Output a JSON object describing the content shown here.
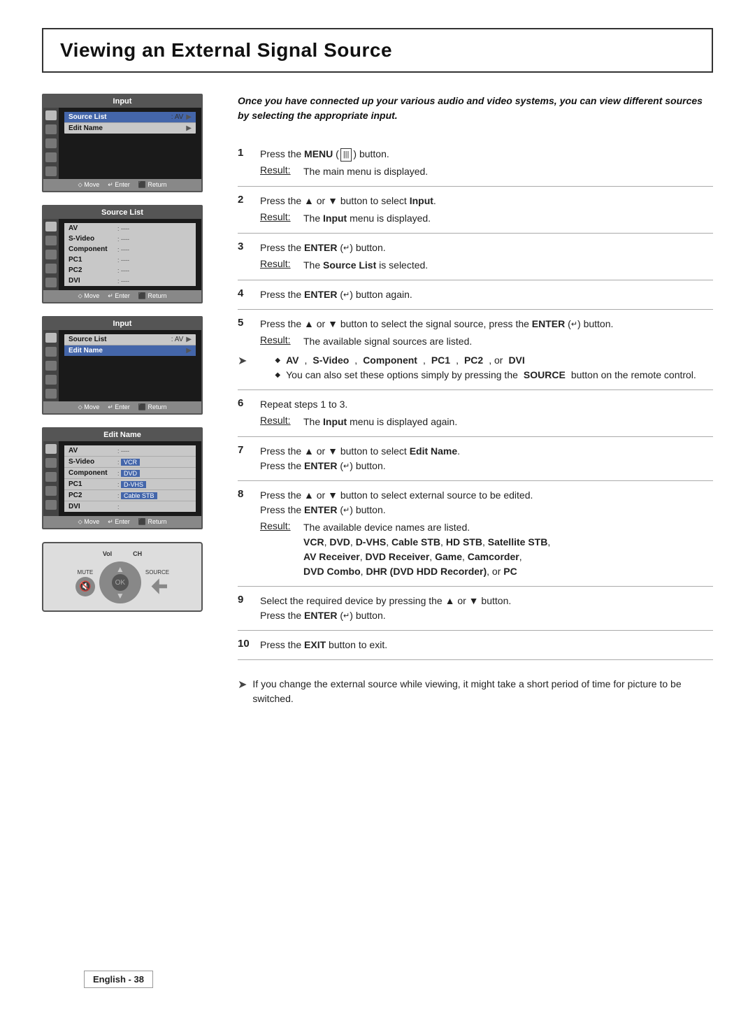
{
  "page": {
    "title": "Viewing an External Signal Source",
    "footer": "English - 38"
  },
  "intro": {
    "text": "Once you have connected up your various audio and video systems, you can view different sources by selecting the appropriate input."
  },
  "panels": {
    "panel1": {
      "header": "Input",
      "rows": [
        {
          "label": "Source List",
          "value": ": AV",
          "hasArrow": true,
          "selected": true
        },
        {
          "label": "Edit Name",
          "value": "",
          "hasArrow": true,
          "selected": false
        }
      ]
    },
    "panel2": {
      "header": "Source List",
      "rows": [
        {
          "label": "AV",
          "value": " : ----"
        },
        {
          "label": "S-Video",
          "value": " : ----"
        },
        {
          "label": "Component",
          "value": " : ----"
        },
        {
          "label": "PC1",
          "value": " : ----"
        },
        {
          "label": "PC2",
          "value": " : ----"
        },
        {
          "label": "DVI",
          "value": " : ----"
        }
      ]
    },
    "panel3": {
      "header": "Input",
      "rows": [
        {
          "label": "Source List",
          "value": ": AV",
          "hasArrow": true,
          "selected": false
        },
        {
          "label": "Edit Name",
          "value": "",
          "hasArrow": true,
          "selected": true
        }
      ]
    },
    "panel4": {
      "header": "Edit Name",
      "rows": [
        {
          "label": "AV",
          "value": "----"
        },
        {
          "label": "S-Video",
          "value": "VCR"
        },
        {
          "label": "Component",
          "value": "DVD"
        },
        {
          "label": "PC1",
          "value": "D-VHS"
        },
        {
          "label": "PC2",
          "value": "Cable STB"
        },
        {
          "label": "DVI",
          "value": ""
        }
      ]
    }
  },
  "footer_nav": {
    "move": "⬦ Move",
    "enter": "↵ Enter",
    "return": "⬛ Return"
  },
  "remote": {
    "vol_label": "Vol",
    "ch_label": "CH",
    "mute_label": "MUTE",
    "source_label": "SOURCE"
  },
  "steps": [
    {
      "num": "1",
      "text_parts": [
        "Press the ",
        "MENU",
        " (",
        "|||",
        ") button."
      ],
      "result": "The main menu is displayed."
    },
    {
      "num": "2",
      "text_parts": [
        "Press the ▲ or ▼ button to select ",
        "Input",
        "."
      ],
      "result_prefix": "The ",
      "result_bold": "Input",
      "result_suffix": " menu is displayed."
    },
    {
      "num": "3",
      "text_parts": [
        "Press the ",
        "ENTER",
        " (↵) button."
      ],
      "result_prefix": "The ",
      "result_bold": "Source List",
      "result_suffix": " is selected."
    },
    {
      "num": "4",
      "text_parts": [
        "Press the ",
        "ENTER",
        " (↵) button again."
      ],
      "result": null
    },
    {
      "num": "5",
      "text_parts": [
        "Press the ▲ or ▼ button to select the signal source, press the ",
        "ENTER",
        " (↵) button."
      ],
      "result": "The available signal sources are listed.",
      "note": "➤",
      "bullets": [
        "AV, S-Video, Component, PC1, PC2, or DVI",
        "You can also set these options simply by pressing the SOURCE button on the remote control."
      ]
    },
    {
      "num": "6",
      "text": "Repeat steps 1 to 3.",
      "result_prefix": "The ",
      "result_bold": "Input",
      "result_suffix": " menu is displayed again."
    },
    {
      "num": "7",
      "text_parts": [
        "Press the ▲ or ▼ button to select ",
        "Edit Name",
        "."
      ],
      "text2_parts": [
        "Press the ",
        "ENTER",
        " (↵) button."
      ],
      "result": null
    },
    {
      "num": "8",
      "text_parts": [
        "Press the ▲ or ▼ button to select external source to be edited."
      ],
      "text2_parts": [
        "Press the ",
        "ENTER",
        " (↵) button."
      ],
      "result": "The available device names are listed.",
      "result2": "VCR, DVD, D-VHS, Cable STB, HD STB, Satellite STB, AV Receiver, DVD Receiver, Game, Camcorder, DVD Combo, DHR (DVD HDD Recorder), or PC"
    },
    {
      "num": "9",
      "text_parts": [
        "Select the required device by pressing the ▲ or ▼ button."
      ],
      "text2_parts": [
        "Press the ",
        "ENTER",
        " (↵) button."
      ],
      "result": null
    },
    {
      "num": "10",
      "text_parts": [
        "Press the ",
        "EXIT",
        " button to exit."
      ],
      "result": null
    }
  ],
  "final_note": "If you change the external source while viewing, it might take a short period of time for picture to be switched."
}
